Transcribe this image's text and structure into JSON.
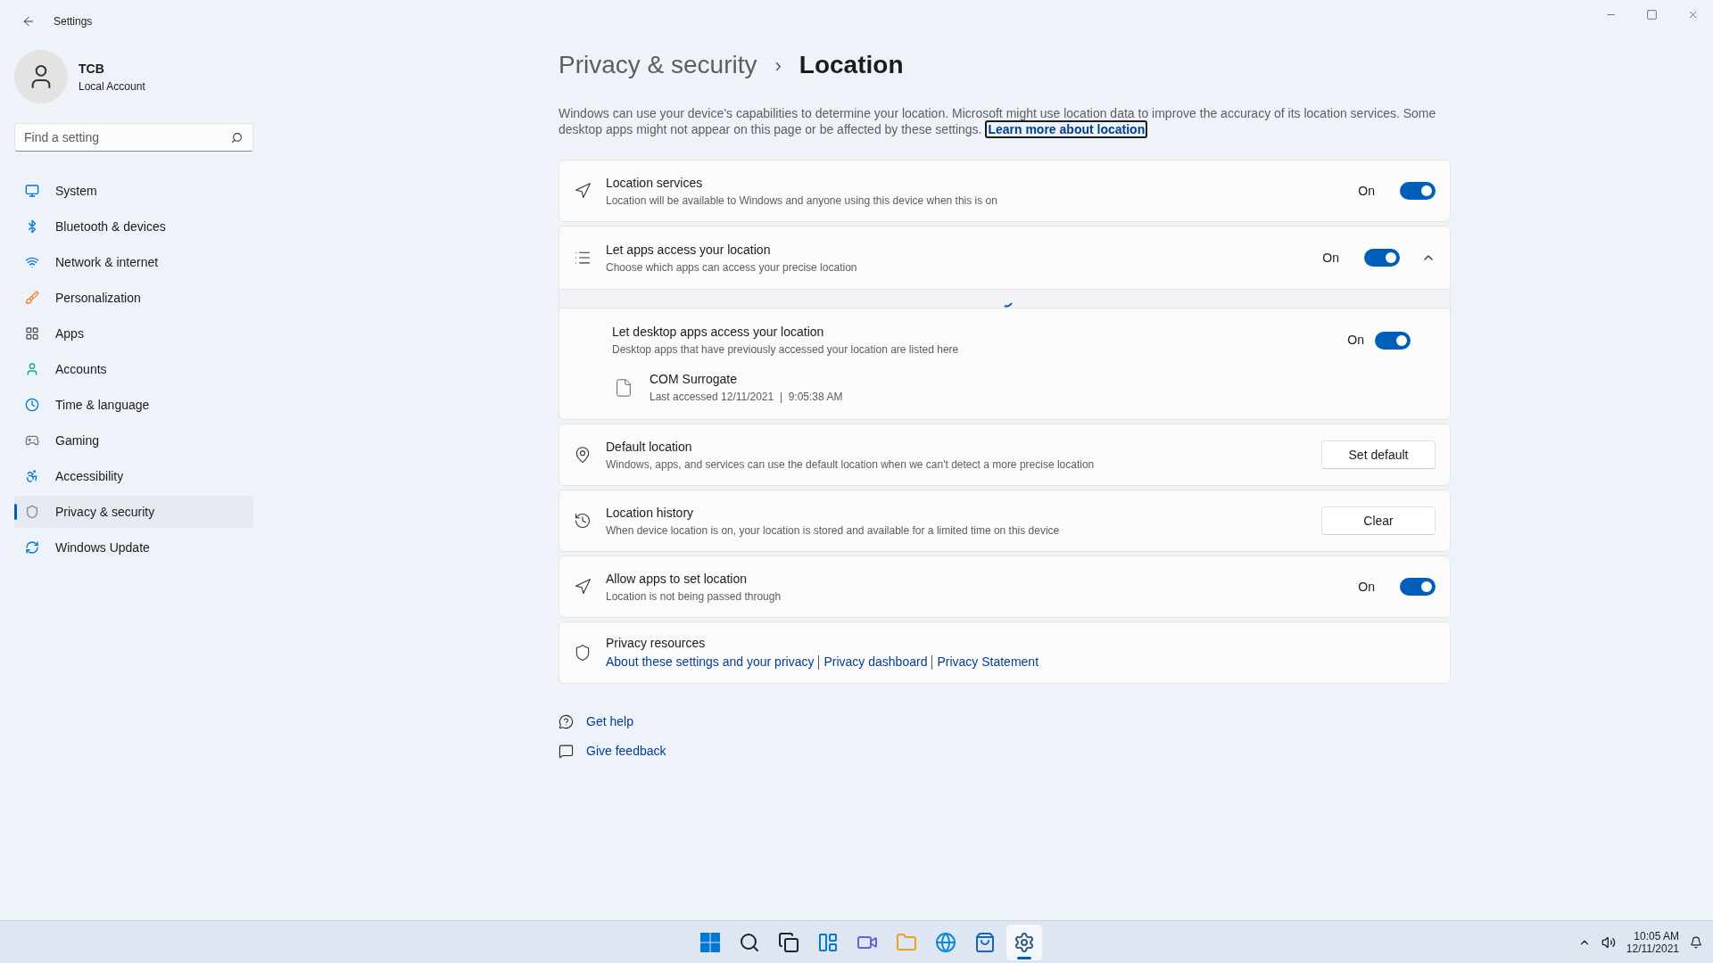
{
  "window": {
    "title": "Settings"
  },
  "account": {
    "name": "TCB",
    "type": "Local Account"
  },
  "search": {
    "placeholder": "Find a setting"
  },
  "sidebar": {
    "items": [
      {
        "label": "System",
        "selected": false
      },
      {
        "label": "Bluetooth & devices",
        "selected": false
      },
      {
        "label": "Network & internet",
        "selected": false
      },
      {
        "label": "Personalization",
        "selected": false
      },
      {
        "label": "Apps",
        "selected": false
      },
      {
        "label": "Accounts",
        "selected": false
      },
      {
        "label": "Time & language",
        "selected": false
      },
      {
        "label": "Gaming",
        "selected": false
      },
      {
        "label": "Accessibility",
        "selected": false
      },
      {
        "label": "Privacy & security",
        "selected": true
      },
      {
        "label": "Windows Update",
        "selected": false
      }
    ]
  },
  "breadcrumb": {
    "parent": "Privacy & security",
    "separator": "›",
    "current": "Location"
  },
  "description": {
    "text": "Windows can use your device’s capabilities to determine your location. Microsoft might use location data to improve the accuracy of its location services. Some desktop apps might not appear on this page or be affected by these settings.",
    "link": "Learn more about location"
  },
  "cards": [
    {
      "kind": "toggle",
      "title": "Location services",
      "description": "Location will be available to Windows and anyone using this device when this is on",
      "state_label": "On",
      "on": true
    },
    {
      "kind": "expander",
      "title": "Let apps access your location",
      "description": "Choose which apps can access your precise location",
      "state_label": "On",
      "on": true,
      "expanded": true,
      "sub": {
        "title": "Let desktop apps access your location",
        "description": "Desktop apps that have previously accessed your location are listed here",
        "state_label": "On",
        "on": true,
        "apps": [
          {
            "name": "COM Surrogate",
            "detail": "Last accessed 12/11/2021  |  9:05:38 AM"
          }
        ]
      }
    },
    {
      "kind": "button",
      "title": "Default location",
      "description": "Windows, apps, and services can use the default location when we can't detect a more precise location",
      "button": "Set default"
    },
    {
      "kind": "button",
      "title": "Location history",
      "description": "When device location is on, your location is stored and available for a limited time on this device",
      "button": "Clear"
    },
    {
      "kind": "toggle",
      "title": "Allow apps to set location",
      "description": "Location is not being passed through",
      "state_label": "On",
      "on": true
    },
    {
      "kind": "links",
      "title": "Privacy resources",
      "links": [
        "About these settings and your privacy",
        "Privacy dashboard",
        "Privacy Statement"
      ]
    }
  ],
  "help_links": [
    "Get help",
    "Give feedback"
  ],
  "taskbar": {
    "apps": [
      {
        "selected": false
      },
      {
        "selected": false
      },
      {
        "selected": false
      },
      {
        "selected": false
      },
      {
        "selected": false
      },
      {
        "selected": false
      },
      {
        "selected": false
      },
      {
        "selected": false
      },
      {
        "selected": true
      }
    ],
    "time": "10:05 AM",
    "date": "12/11/2021"
  }
}
